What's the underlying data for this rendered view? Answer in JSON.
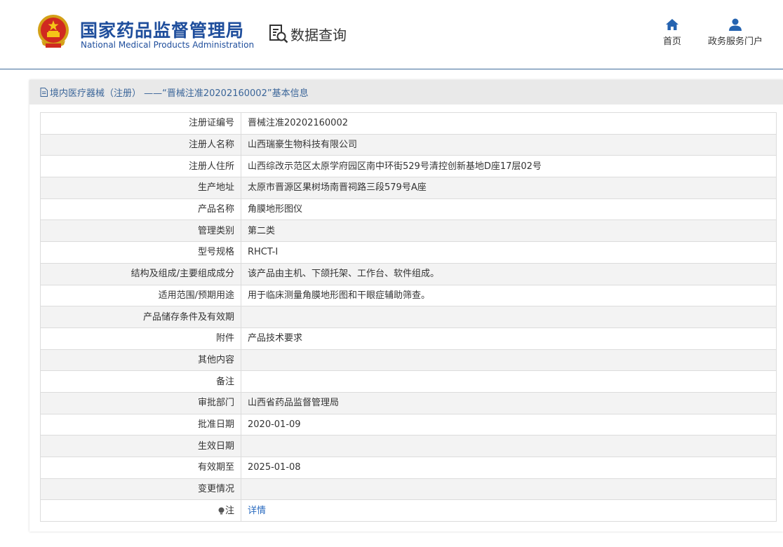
{
  "header": {
    "brand_cn": "国家药品监督管理局",
    "brand_en": "National Medical Products Administration",
    "query_title": "数据查询",
    "nav": {
      "home": "首页",
      "portal": "政务服务门户"
    },
    "colors": {
      "brand": "#1f4e9c",
      "nav_icon": "#2563b0"
    }
  },
  "record": {
    "title": "境内医疗器械（注册） ——“晋械注准20202160002”基本信息",
    "rows": [
      {
        "label": "注册证编号",
        "value": "晋械注准20202160002"
      },
      {
        "label": "注册人名称",
        "value": "山西瑞豪生物科技有限公司"
      },
      {
        "label": "注册人住所",
        "value": "山西综改示范区太原学府园区南中环街529号清控创新基地D座17层02号"
      },
      {
        "label": "生产地址",
        "value": "太原市晋源区果树场南晋祠路三段579号A座"
      },
      {
        "label": "产品名称",
        "value": "角膜地形图仪"
      },
      {
        "label": "管理类别",
        "value": "第二类"
      },
      {
        "label": "型号规格",
        "value": "RHCT-I"
      },
      {
        "label": "结构及组成/主要组成成分",
        "value": "该产品由主机、下颌托架、工作台、软件组成。"
      },
      {
        "label": "适用范围/预期用途",
        "value": "用于临床测量角膜地形图和干眼症辅助筛查。"
      },
      {
        "label": "产品储存条件及有效期",
        "value": ""
      },
      {
        "label": "附件",
        "value": "产品技术要求"
      },
      {
        "label": "其他内容",
        "value": ""
      },
      {
        "label": "备注",
        "value": ""
      },
      {
        "label": "审批部门",
        "value": "山西省药品监督管理局"
      },
      {
        "label": "批准日期",
        "value": "2020-01-09"
      },
      {
        "label": "生效日期",
        "value": ""
      },
      {
        "label": "有效期至",
        "value": "2025-01-08"
      },
      {
        "label": "变更情况",
        "value": ""
      }
    ],
    "note_label": "注",
    "note_link": "详情",
    "link_color": "#2a6bc0"
  }
}
